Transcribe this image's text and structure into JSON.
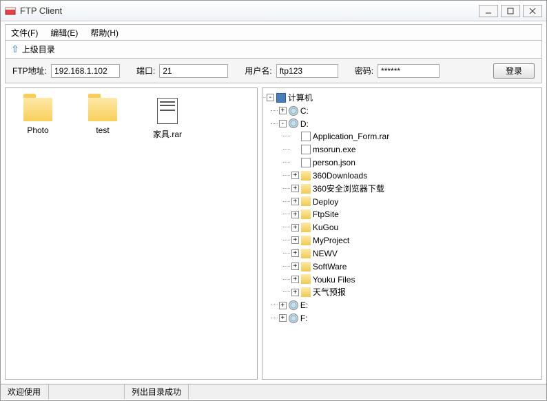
{
  "window": {
    "title": "FTP Client"
  },
  "menu": {
    "file": "文件(F)",
    "edit": "编辑(E)",
    "help": "帮助(H)"
  },
  "toolbar": {
    "up_dir": "上级目录"
  },
  "conn": {
    "addr_label": "FTP地址:",
    "addr_value": "192.168.1.102",
    "port_label": "端口:",
    "port_value": "21",
    "user_label": "用户名:",
    "user_value": "ftp123",
    "pass_label": "密码:",
    "pass_value": "******",
    "login": "登录"
  },
  "local_files": [
    {
      "name": "Photo",
      "type": "folder"
    },
    {
      "name": "test",
      "type": "folder"
    },
    {
      "name": "家具.rar",
      "type": "rar"
    }
  ],
  "tree": {
    "root": "计算机",
    "drives": [
      {
        "name": "C:",
        "expanded": false
      },
      {
        "name": "D:",
        "expanded": true,
        "files": [
          "Application_Form.rar",
          "msorun.exe",
          "person.json"
        ],
        "folders": [
          "360Downloads",
          "360安全浏览器下载",
          "Deploy",
          "FtpSite",
          "KuGou",
          "MyProject",
          "NEWV",
          "SoftWare",
          "Youku Files",
          "天气预报"
        ]
      },
      {
        "name": "E:",
        "expanded": false
      },
      {
        "name": "F:",
        "expanded": false
      }
    ]
  },
  "status": {
    "left": "欢迎使用",
    "right": "列出目录成功"
  }
}
